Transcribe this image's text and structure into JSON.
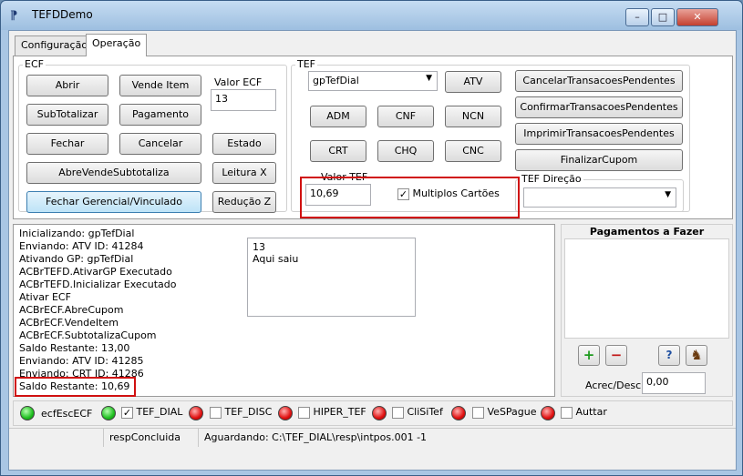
{
  "window": {
    "title": "TEFDDemo",
    "minimize": "–",
    "maximize": "□",
    "close": "✕"
  },
  "tabs": [
    {
      "label": "Configuração"
    },
    {
      "label": "Operação"
    }
  ],
  "ecf": {
    "title": "ECF",
    "buttons": {
      "abrir": "Abrir",
      "vende_item": "Vende Item",
      "subtotalizar": "SubTotalizar",
      "pagamento": "Pagamento",
      "fechar": "Fechar",
      "cancelar": "Cancelar",
      "estado": "Estado",
      "abre_vende_subtotaliza": "AbreVendeSubtotaliza",
      "leitura_x": "Leitura X",
      "fechar_gerencial": "Fechar Gerencial/Vinculado",
      "reducao_z": "Redução Z"
    },
    "valor_label": "Valor ECF",
    "valor": "13"
  },
  "tef": {
    "title": "TEF",
    "combo_value": "gpTefDial",
    "buttons": {
      "atv": "ATV",
      "adm": "ADM",
      "cnf": "CNF",
      "ncn": "NCN",
      "crt": "CRT",
      "chq": "CHQ",
      "cnc": "CNC",
      "cancelar_pendentes": "CancelarTransacoesPendentes",
      "confirmar_pendentes": "ConfirmarTransacoesPendentes",
      "imprimir_pendentes": "ImprimirTransacoesPendentes",
      "finalizar_cupom": "FinalizarCupom"
    },
    "valor_label": "Valor TEF",
    "valor": "10,69",
    "multiplos_label": "Multiplos Cartões",
    "multiplos_checked": "✓",
    "direcao_label": "TEF Direção",
    "direcao_value": ""
  },
  "log": [
    "Inicializando: gpTefDial",
    "Enviando: ATV ID: 41284",
    "Ativando GP: gpTefDial",
    "ACBrTEFD.AtivarGP Executado",
    "ACBrTEFD.Inicializar Executado",
    "Ativar ECF",
    "ACBrECF.AbreCupom",
    "ACBrECF.VendeItem",
    "ACBrECF.SubtotalizaCupom",
    "Saldo Restante: 13,00",
    "Enviando: ATV ID: 41285",
    "Enviando: CRT ID: 41286",
    "Saldo Restante: 10,69"
  ],
  "memo": [
    "13",
    "Aqui saiu"
  ],
  "pagamentos": {
    "title": "Pagamentos a Fazer",
    "acrec_label": "Acrec/Desc",
    "acrec_value": "0,00",
    "add_icon": "+",
    "remove_icon": "−",
    "help_icon": "?",
    "horse_icon": "♞"
  },
  "status": {
    "ecf_esc_label": "ecfEscECF",
    "gps": [
      {
        "label": "TEF_DIAL",
        "checked": "✓",
        "led": "green"
      },
      {
        "label": "TEF_DISC",
        "checked": "",
        "led": "red"
      },
      {
        "label": "HIPER_TEF",
        "checked": "",
        "led": "red"
      },
      {
        "label": "CliSiTef",
        "checked": "",
        "led": "red"
      },
      {
        "label": "VeSPague",
        "checked": "",
        "led": "red"
      },
      {
        "label": "Auttar",
        "checked": "",
        "led": "red"
      }
    ]
  },
  "statusbar": {
    "resp": "respConcluida",
    "aguardando": "Aguardando: C:\\TEF_DIAL\\resp\\intpos.001 -1"
  },
  "colors": {
    "highlight": "#d01010",
    "led_green": "#1fbf1f",
    "led_red": "#e01010"
  }
}
